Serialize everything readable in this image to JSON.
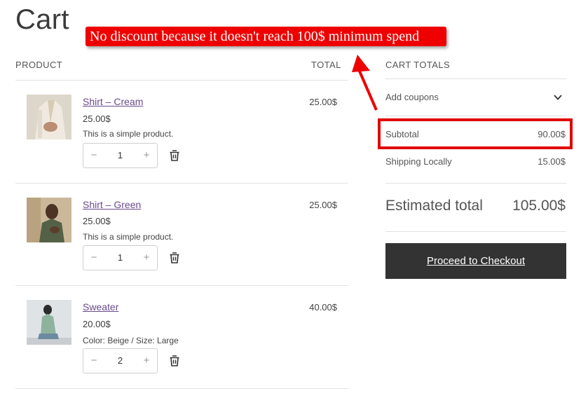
{
  "page": {
    "title": "Cart"
  },
  "annotation": {
    "text": "No discount because it doesn't reach 100$ minimum spend"
  },
  "table": {
    "product_header": "PRODUCT",
    "total_header": "TOTAL"
  },
  "items": [
    {
      "name": "Shirt – Cream",
      "price": "25.00$",
      "description": "This is a simple product.",
      "quantity": "1",
      "total": "25.00$"
    },
    {
      "name": "Shirt – Green",
      "price": "25.00$",
      "description": "This is a simple product.",
      "quantity": "1",
      "total": "25.00$"
    },
    {
      "name": "Sweater",
      "price": "20.00$",
      "description": "Color: Beige / Size: Large",
      "quantity": "2",
      "total": "40.00$"
    }
  ],
  "qty_controls": {
    "minus": "−",
    "plus": "+"
  },
  "totals": {
    "header": "CART TOTALS",
    "coupons_label": "Add coupons",
    "subtotal_label": "Subtotal",
    "subtotal_value": "90.00$",
    "shipping_label": "Shipping Locally",
    "shipping_value": "15.00$",
    "estimated_label": "Estimated total",
    "estimated_value": "105.00$"
  },
  "checkout": {
    "label": "Proceed to Checkout"
  },
  "colors": {
    "annotation": "#ee0000",
    "highlight": "#e00000",
    "link": "#6a4a8c",
    "checkout_bg": "#333333"
  },
  "icons": {
    "trash": "trash-icon",
    "chevron": "chevron-down-icon",
    "arrow": "arrow-up-icon"
  }
}
